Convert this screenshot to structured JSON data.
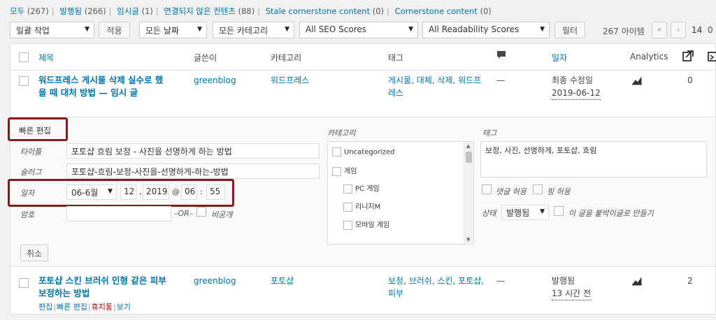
{
  "status_links": {
    "all": "모두",
    "all_count": "(267)",
    "published": "발행됨",
    "published_count": "(266)",
    "draft": "임시글",
    "draft_count": "(1)",
    "unlinked": "연결되지 않은 컨텐츠",
    "unlinked_count": "(88)",
    "stale": "Stale cornerstone content",
    "stale_count": "(0)",
    "cornerstone": "Cornerstone content",
    "cornerstone_count": "(0)"
  },
  "filters": {
    "bulk_action": "일괄 작업",
    "apply": "적용",
    "all_dates": "모든 날짜",
    "all_categories": "모든 카테고리",
    "seo": "All SEO Scores",
    "readability": "All Readability Scores",
    "filter_button": "필터",
    "item_count": "267 아이템",
    "first_page": "«",
    "prev_page": "‹",
    "current_page": "14",
    "page_of": "0"
  },
  "columns": {
    "title": "제목",
    "author": "글쓴이",
    "categories": "카테고리",
    "tags": "태그",
    "date": "일자",
    "analytics": "Analytics"
  },
  "row1": {
    "title_line1": "워드프레스 게시물 삭제 실수로 했",
    "title_line2": "을 때 대처 방법 — 임시 글",
    "author": "greenblog",
    "category": "워드프레스",
    "tags_line1": "게시물, 대체, 삭제, 워드프",
    "tags_line2": "레스",
    "comments": "—",
    "date_label": "최종 수정일",
    "date_value": "2019-06-12",
    "count": "0"
  },
  "quick_edit": {
    "heading": "빠른 편집",
    "title_label": "타이틀",
    "title_value": "포토샵 흐림 보정 - 사진을 선명하게 하는 방법",
    "slug_label": "슬러그",
    "slug_value": "포토샵-흐림-보정-사진을-선명하게-하는-방법",
    "date_label": "일자",
    "month": "06-6월",
    "day": "12",
    "year": "2019",
    "at": "@",
    "hour": "06",
    "colon": ":",
    "minute": "55",
    "comma": ",",
    "password_label": "암호",
    "or_text": "–OR–",
    "private_label": "비공개",
    "categories_heading": "카테고리",
    "categories": [
      "Uncategorized",
      "게임",
      "PC 게임",
      "리니지M",
      "모바일 게임"
    ],
    "tags_heading": "태그",
    "tags_value": "보정, 사진, 선명하게, 포토샵, 흐림",
    "allow_comments": "댓글 허용",
    "allow_pings": "핑 허용",
    "status_label": "상태",
    "status_value": "발행됨",
    "sticky_label": "이 글을 붙박이글로 만들기",
    "cancel": "취소"
  },
  "row2": {
    "title_line1": "포토샵 스킨 브러쉬 인형 같은 피부",
    "title_line2": "보정하는 방법",
    "author": "greenblog",
    "category": "포토샵",
    "tags_line1": "보정, 브러쉬, 스킨, 포토샵,",
    "tags_line2": "피부",
    "comments": "—",
    "date_label": "발행됨",
    "date_value": "13 시간 전",
    "count": "2",
    "actions": {
      "edit": "편집",
      "quick_edit": "빠른 편집",
      "trash": "휴지통",
      "view": "보기",
      "sep": "|"
    }
  },
  "colors": {
    "link": "#0073aa",
    "highlight_box": "#8b1a1a",
    "trash": "#aa0000"
  }
}
